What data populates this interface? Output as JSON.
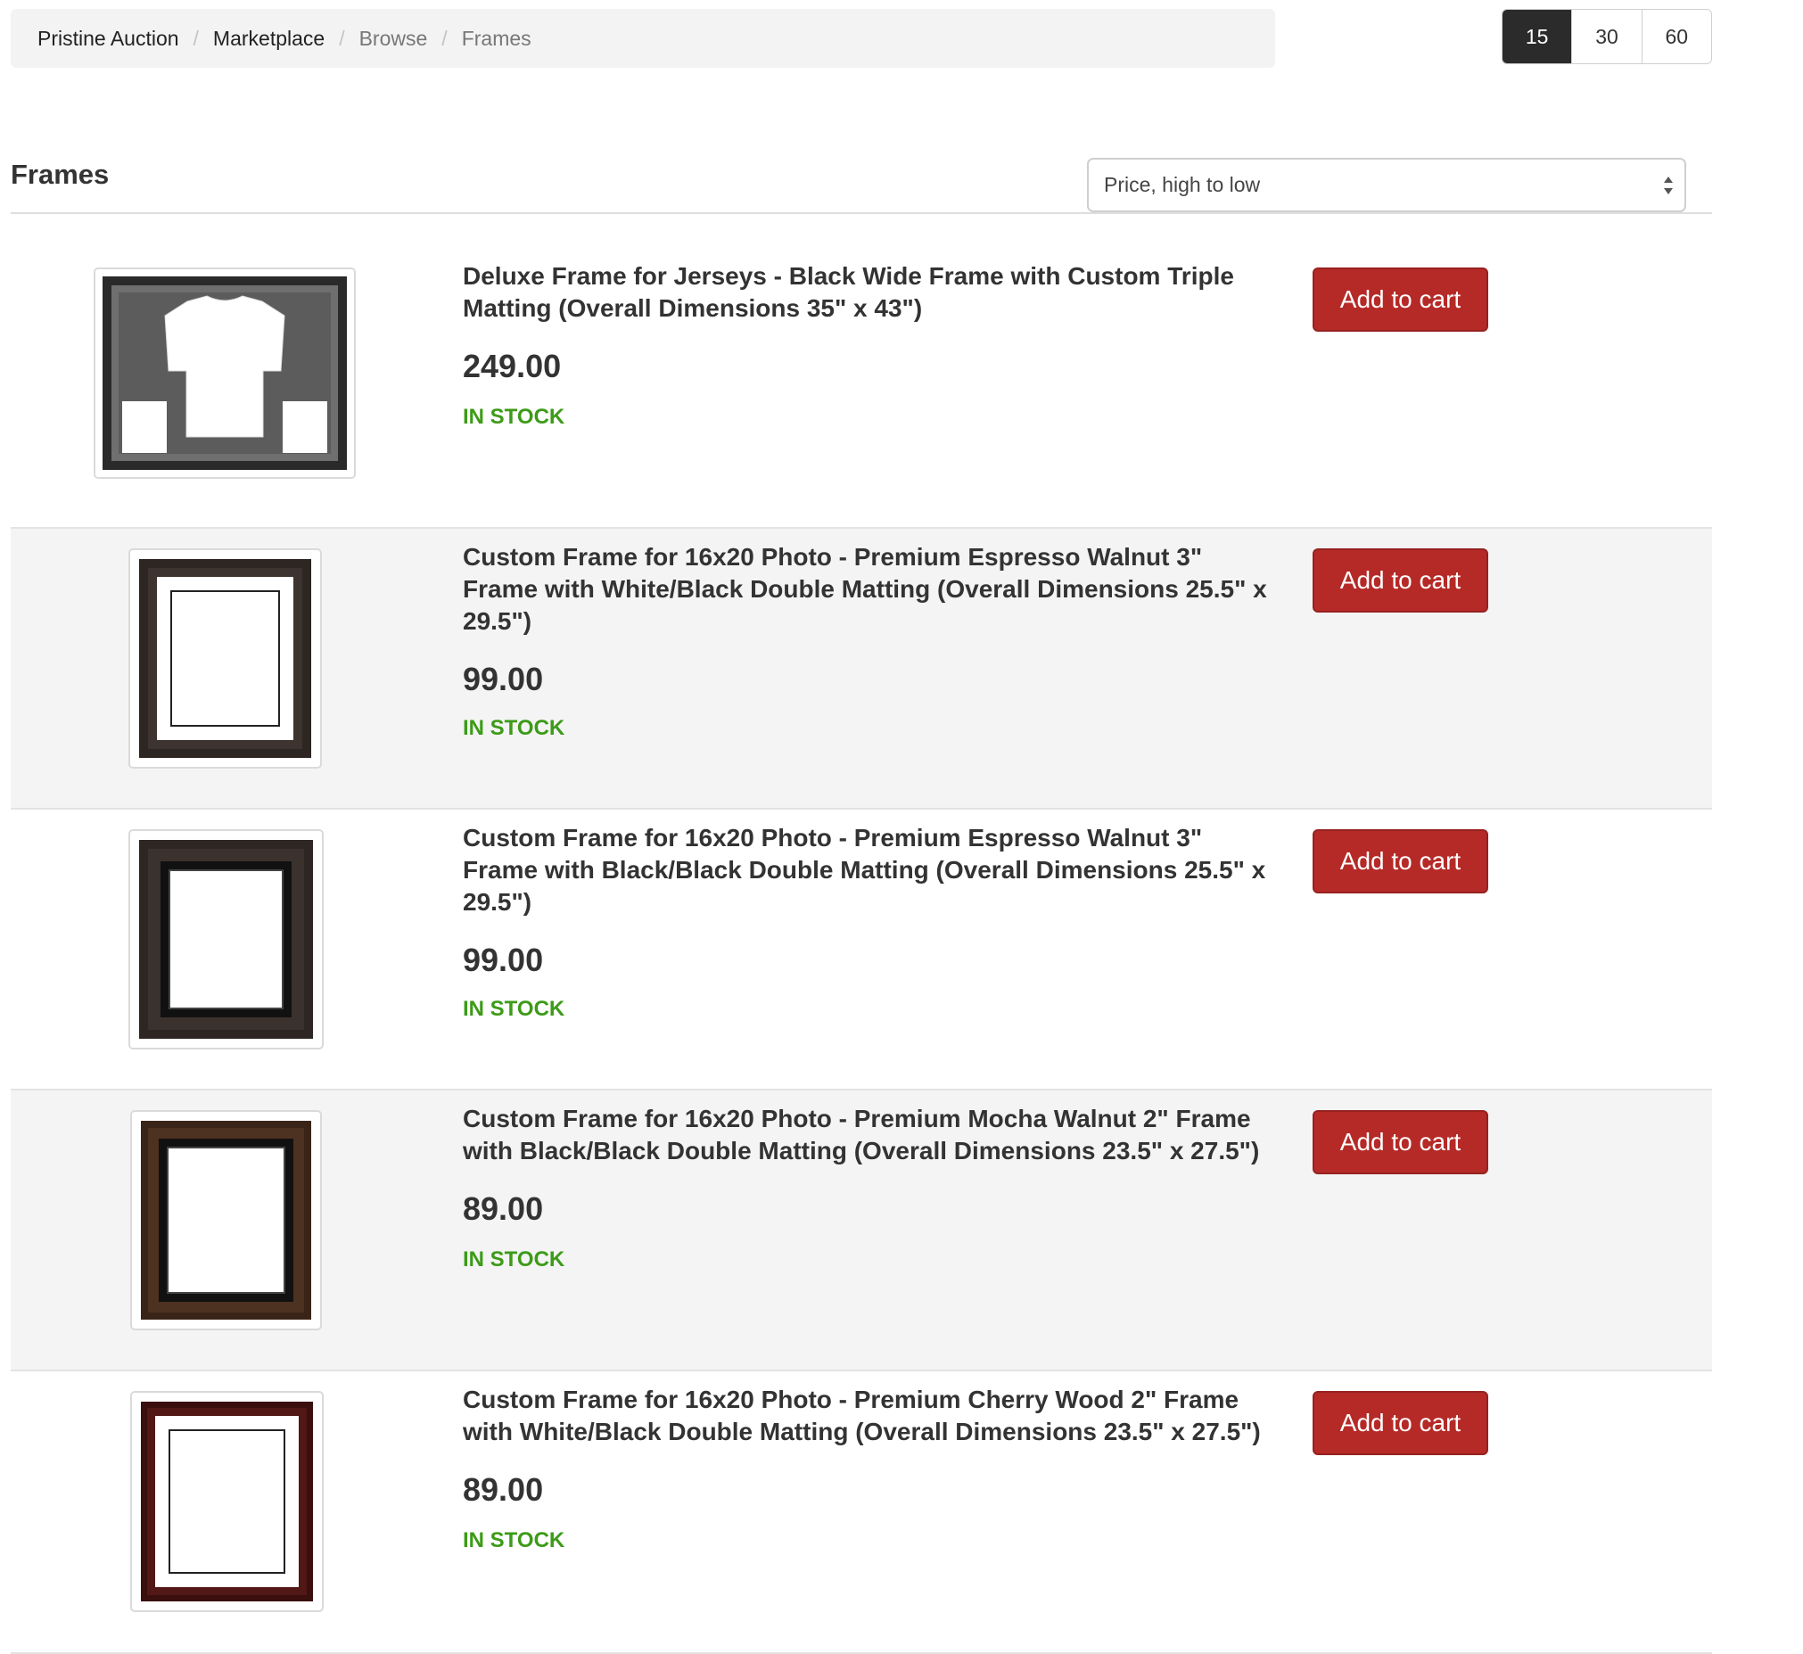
{
  "breadcrumb": {
    "items": [
      {
        "label": "Pristine Auction"
      },
      {
        "label": "Marketplace"
      },
      {
        "label": "Browse"
      },
      {
        "label": "Frames"
      }
    ],
    "separator": "/"
  },
  "per_page": {
    "options": [
      "15",
      "30",
      "60"
    ],
    "selected": "15"
  },
  "page_title": "Frames",
  "sort": {
    "selected": "Price, high to low"
  },
  "products": [
    {
      "title": "Deluxe Frame for Jerseys - Black Wide Frame with Custom Triple Matting (Overall Dimensions 35\" x 43\")",
      "price": "249.00",
      "stock": "IN STOCK",
      "button": "Add to cart",
      "image": "jersey-frame-icon"
    },
    {
      "title": "Custom Frame for 16x20 Photo - Premium Espresso Walnut 3\" Frame with White/Black Double Matting (Overall Dimensions 25.5\" x 29.5\")",
      "price": "99.00",
      "stock": "IN STOCK",
      "button": "Add to cart",
      "image": "espresso-white-mat-frame-icon"
    },
    {
      "title": "Custom Frame for 16x20 Photo - Premium Espresso Walnut 3\" Frame with Black/Black Double Matting (Overall Dimensions 25.5\" x 29.5\")",
      "price": "99.00",
      "stock": "IN STOCK",
      "button": "Add to cart",
      "image": "espresso-black-mat-frame-icon"
    },
    {
      "title": "Custom Frame for 16x20 Photo - Premium Mocha Walnut 2\" Frame with Black/Black Double Matting (Overall Dimensions 23.5\" x 27.5\")",
      "price": "89.00",
      "stock": "IN STOCK",
      "button": "Add to cart",
      "image": "mocha-black-mat-frame-icon"
    },
    {
      "title": "Custom Frame for 16x20 Photo - Premium Cherry Wood 2\" Frame with White/Black Double Matting (Overall Dimensions 23.5\" x 27.5\")",
      "price": "89.00",
      "stock": "IN STOCK",
      "button": "Add to cart",
      "image": "cherry-white-mat-frame-icon"
    }
  ],
  "colors": {
    "accent_button": "#b52a27",
    "in_stock": "#3c9b18",
    "active_toggle": "#2b2b2b"
  }
}
